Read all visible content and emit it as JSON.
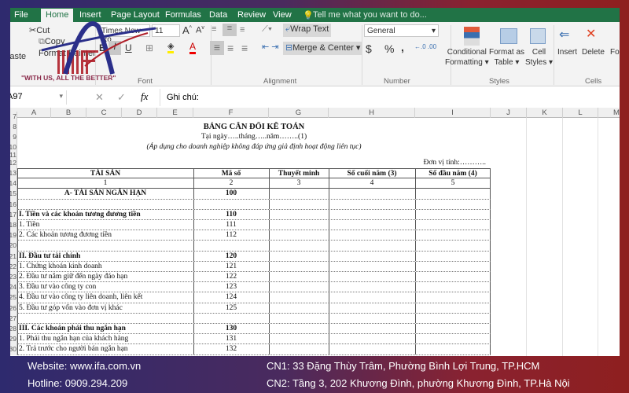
{
  "tabs": [
    "File",
    "Home",
    "Insert",
    "Page Layout",
    "Formulas",
    "Data",
    "Review",
    "View"
  ],
  "tell_me": "Tell me what you want to do...",
  "clipboard": {
    "cut": "Cut",
    "copy": "Copy",
    "paste": "Paste",
    "format_painter": "Format Painter"
  },
  "font": {
    "name": "Times New Ro",
    "size": "11",
    "group": "Font",
    "bold": "B",
    "italic": "I",
    "underline": "U"
  },
  "alignment": {
    "wrap": "Wrap Text",
    "merge": "Merge & Center",
    "group": "Alignment"
  },
  "number": {
    "format": "General",
    "currency": "$",
    "percent": "%",
    "comma": ",",
    "group": "Number"
  },
  "styles": {
    "conditional": "Conditional",
    "conditional2": "Formatting",
    "format_table": "Format as",
    "format_table2": "Table",
    "cell_styles": "Cell",
    "cell_styles2": "Styles",
    "group": "Styles"
  },
  "cells": {
    "insert": "Insert",
    "delete": "Delete",
    "format": "Format",
    "group": "Cells"
  },
  "logo": {
    "text": "\"WITH US, ALL THE BETTER\"",
    "brand": "IFA"
  },
  "formula_bar": {
    "name_box": "A97",
    "fx": "fx",
    "content": "Ghi chú:"
  },
  "columns": [
    "A",
    "B",
    "C",
    "D",
    "E",
    "F",
    "G",
    "H",
    "I",
    "J",
    "K",
    "L",
    "M"
  ],
  "sheet": {
    "title": "BẢNG CÂN ĐỐI KẾ TOÁN",
    "date": "Tại ngày…..tháng…..năm……..(1)",
    "note": "(Áp dụng cho doanh nghiệp không đáp ứng giả định hoạt động liên tục)",
    "unit": "Đơn vị tính:………..",
    "headers": [
      "TÀI SẢN",
      "Mã số",
      "Thuyết minh",
      "Số cuối năm (3)",
      "Số đầu năm (4)"
    ],
    "header_nums": [
      "1",
      "2",
      "3",
      "4",
      "5"
    ],
    "rows": [
      {
        "label": "A- TÀI SẢN NGẮN HẠN",
        "code": "100",
        "style": "center-bold"
      },
      {
        "label": "",
        "code": ""
      },
      {
        "label": "I. Tiền và các khoản tương đương tiền",
        "code": "110",
        "style": "bold"
      },
      {
        "label": "1. Tiền",
        "code": "111"
      },
      {
        "label": "2. Các khoản tương đương tiền",
        "code": "112"
      },
      {
        "label": "",
        "code": ""
      },
      {
        "label": "II. Đầu tư tài chính",
        "code": "120",
        "style": "bold"
      },
      {
        "label": "1. Chứng khoán kinh doanh",
        "code": "121"
      },
      {
        "label": "2. Đầu tư nắm giữ đến ngày đáo hạn",
        "code": "122"
      },
      {
        "label": "3. Đầu tư vào công ty con",
        "code": "123"
      },
      {
        "label": "4. Đầu tư vào công ty liên doanh, liên kết",
        "code": "124"
      },
      {
        "label": "5. Đầu tư góp vốn vào đơn vị khác",
        "code": "125"
      },
      {
        "label": "",
        "code": ""
      },
      {
        "label": "III. Các khoản phải thu ngắn hạn",
        "code": "130",
        "style": "bold"
      },
      {
        "label": "1. Phải thu ngắn hạn của khách hàng",
        "code": "131"
      },
      {
        "label": "2. Trả trước cho người bán ngắn hạn",
        "code": "132"
      }
    ],
    "row_numbers": [
      "7",
      "8",
      "9",
      "10",
      "11",
      "12",
      "13",
      "14",
      "15",
      "16",
      "17",
      "18",
      "19",
      "20",
      "21",
      "22",
      "23",
      "24",
      "25",
      "26",
      "27",
      "28",
      "29",
      "30"
    ]
  },
  "footer": {
    "website": "Website: www.ifa.com.vn",
    "hotline": "Hotline: 0909.294.209",
    "cn1": "CN1: 33 Đặng Thùy Trâm, Phường Bình Lợi Trung, TP.HCM",
    "cn2": "CN2: Tầng 3, 202 Khương Đình, phường Khương Đình, TP.Hà Nội"
  },
  "colors": {
    "excel_green": "#217346",
    "logo_blue": "#2b2f8a",
    "logo_red": "#b0202a"
  }
}
